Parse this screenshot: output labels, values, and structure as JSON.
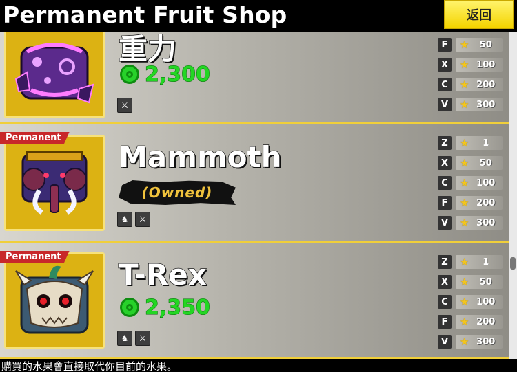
{
  "header": {
    "title": "Permanent Fruit Shop",
    "back_label": "返回"
  },
  "fruits": [
    {
      "name": "重力",
      "badge": "",
      "price": "2,300",
      "owned": false,
      "types": [
        "melee-icon"
      ],
      "moves": [
        {
          "key": "F",
          "mastery": "50"
        },
        {
          "key": "X",
          "mastery": "100"
        },
        {
          "key": "C",
          "mastery": "200"
        },
        {
          "key": "V",
          "mastery": "300"
        }
      ]
    },
    {
      "name": "Mammoth",
      "badge": "Permanent",
      "owned_label": "(Owned)",
      "owned": true,
      "types": [
        "beast-icon",
        "melee-icon"
      ],
      "moves": [
        {
          "key": "Z",
          "mastery": "1"
        },
        {
          "key": "X",
          "mastery": "50"
        },
        {
          "key": "C",
          "mastery": "100"
        },
        {
          "key": "F",
          "mastery": "200"
        },
        {
          "key": "V",
          "mastery": "300"
        }
      ]
    },
    {
      "name": "T-Rex",
      "badge": "Permanent",
      "price": "2,350",
      "owned": false,
      "types": [
        "beast-icon",
        "melee-icon"
      ],
      "moves": [
        {
          "key": "Z",
          "mastery": "1"
        },
        {
          "key": "X",
          "mastery": "50"
        },
        {
          "key": "C",
          "mastery": "100"
        },
        {
          "key": "F",
          "mastery": "200"
        },
        {
          "key": "V",
          "mastery": "300"
        }
      ]
    }
  ],
  "footer": {
    "note": "購買的水果會直接取代你目前的水果。"
  },
  "colors": {
    "accent": "#f4d400",
    "price_green": "#23d624",
    "badge_red": "#c8282a"
  }
}
